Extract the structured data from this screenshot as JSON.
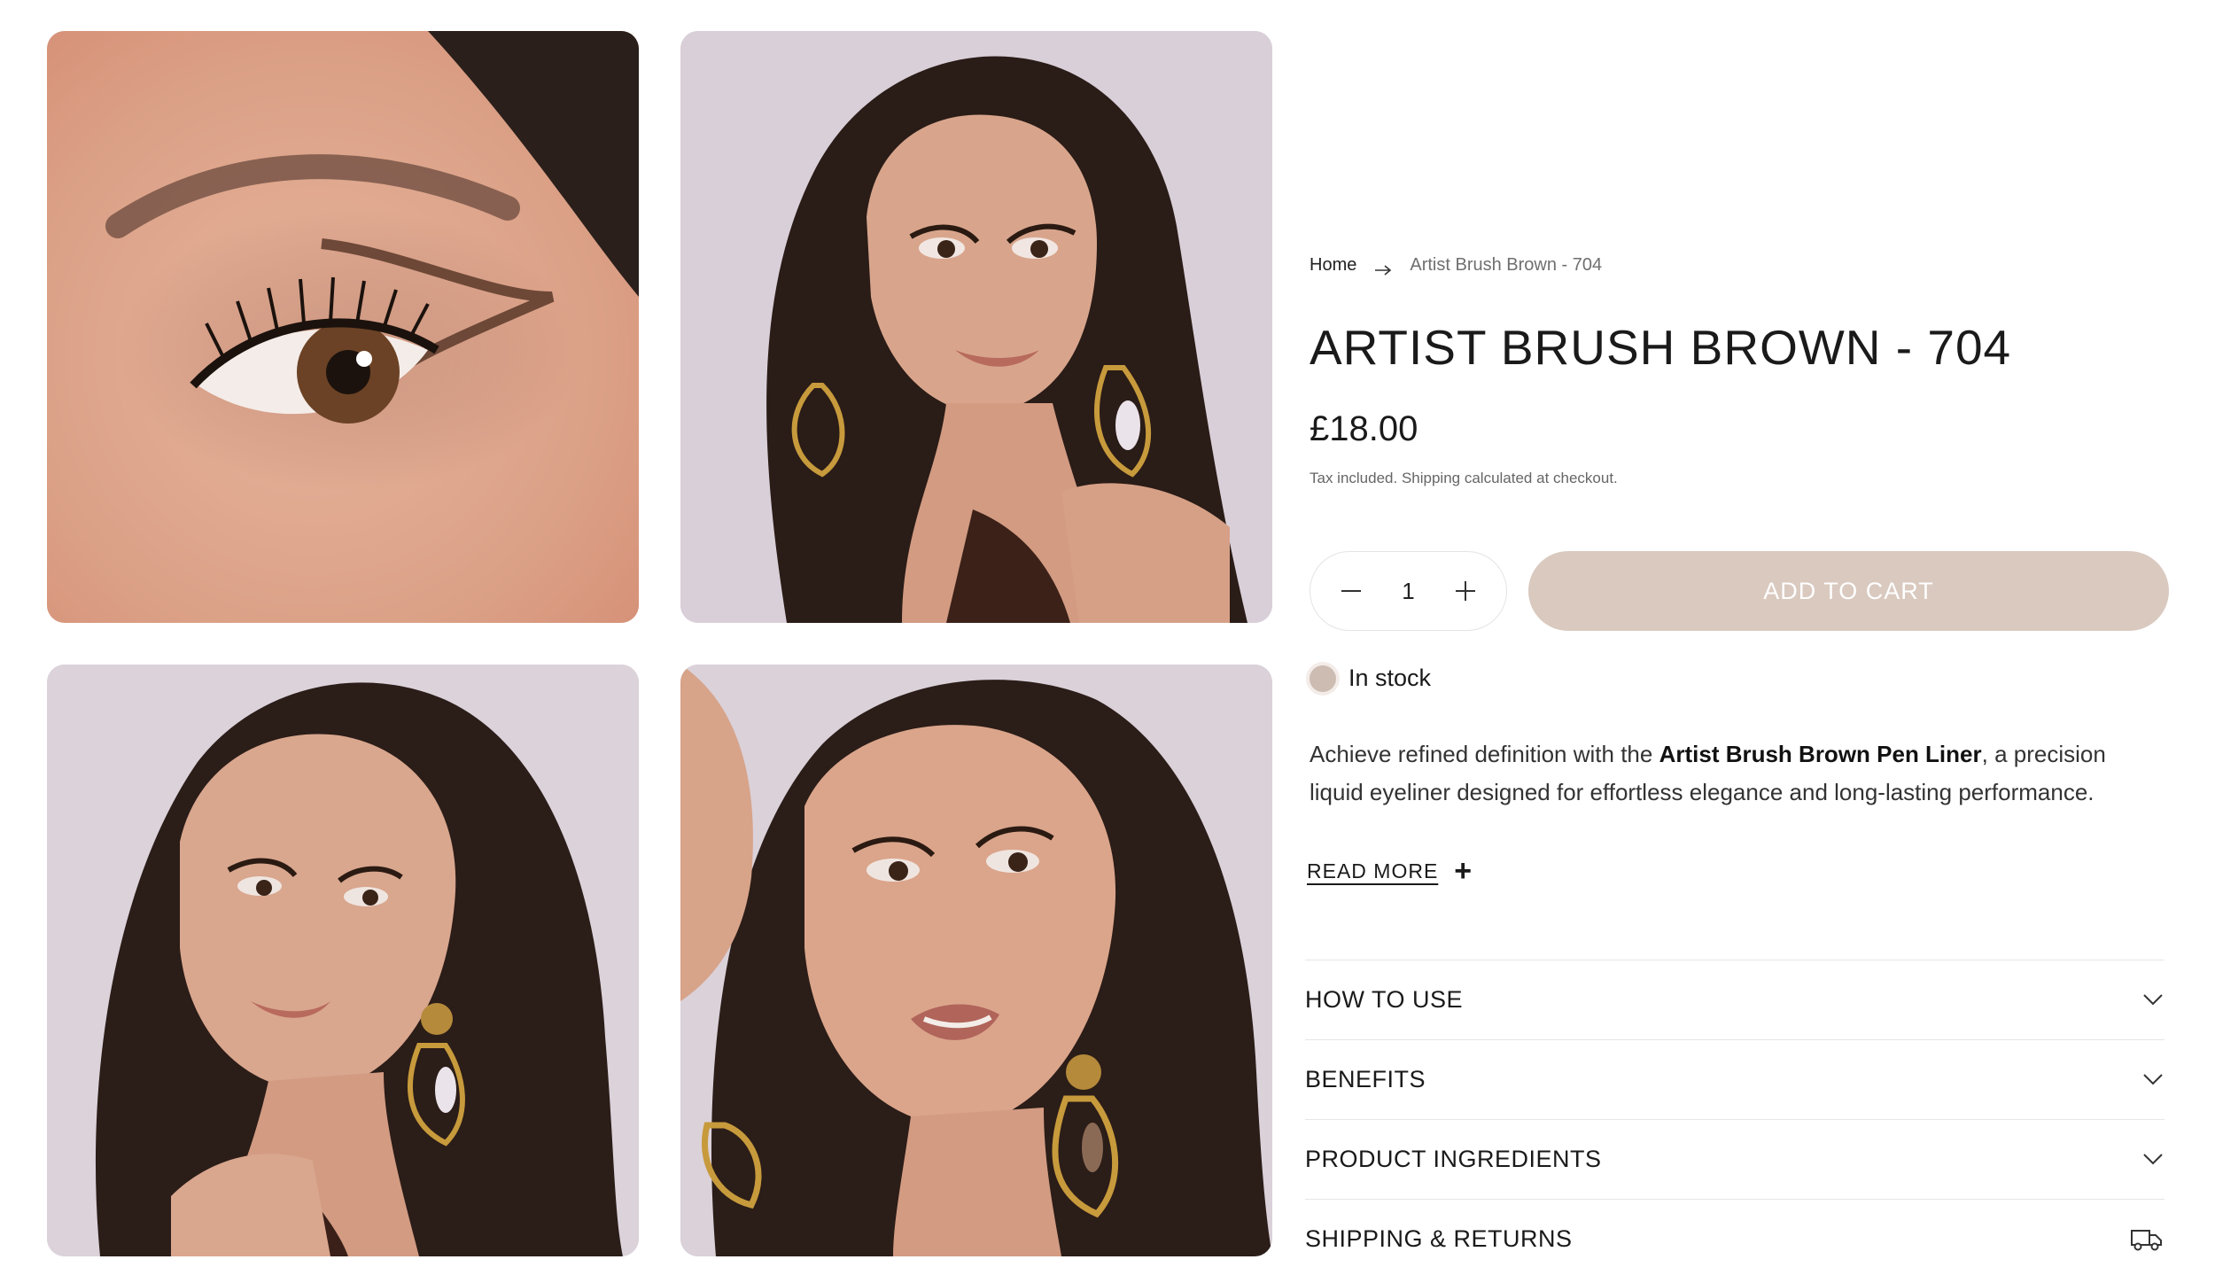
{
  "gallery": {
    "images": [
      {
        "name": "eye-closeup",
        "alt": ""
      },
      {
        "name": "model-portrait-1",
        "alt": ""
      },
      {
        "name": "model-portrait-2",
        "alt": ""
      },
      {
        "name": "model-portrait-3",
        "alt": ""
      }
    ]
  },
  "breadcrumb": {
    "home": "Home",
    "current": "Artist Brush Brown - 704",
    "separator_icon": "arrow-right-icon"
  },
  "product": {
    "title": "ARTIST BRUSH BROWN - 704",
    "price": "£18.00",
    "tax_note": "Tax included. Shipping calculated at checkout.",
    "quantity": "1",
    "add_to_cart_label": "ADD TO CART",
    "stock_status": "In stock",
    "description_prefix": "Achieve refined definition with the ",
    "description_bold": "Artist Brush Brown Pen Liner",
    "description_suffix": ", a precision liquid eyeliner designed for effortless elegance and long-lasting performance.",
    "read_more_label": "READ MORE",
    "read_more_icon": "+"
  },
  "accordion": {
    "items": [
      {
        "label": "HOW TO USE",
        "icon": "chevron-down-icon"
      },
      {
        "label": "BENEFITS",
        "icon": "chevron-down-icon"
      },
      {
        "label": "PRODUCT INGREDIENTS",
        "icon": "chevron-down-icon"
      },
      {
        "label": "SHIPPING & RETURNS",
        "icon": "truck-icon"
      }
    ]
  },
  "colors": {
    "add_to_cart_bg": "#d9c9bf",
    "stock_dot": "#cdbcb2",
    "photo_backdrop": "#d9cfd6"
  }
}
